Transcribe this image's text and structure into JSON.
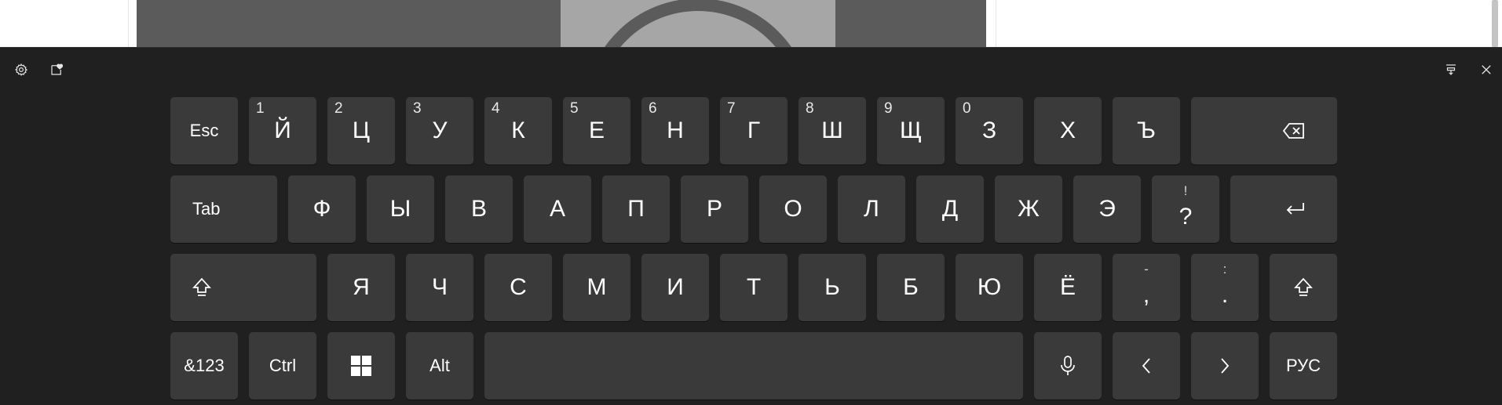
{
  "colors": {
    "background": "#202020",
    "key": "#3a3a3a",
    "text": "#ffffff"
  },
  "toolbar": {
    "settings_icon": "gear-icon",
    "emoji_icon": "emoji-panel-icon",
    "dock_icon": "keyboard-dock-icon",
    "close_icon": "close-icon"
  },
  "rows": {
    "r1": {
      "esc": "Esc",
      "keys": [
        {
          "main": "Й",
          "num": "1"
        },
        {
          "main": "Ц",
          "num": "2"
        },
        {
          "main": "У",
          "num": "3"
        },
        {
          "main": "К",
          "num": "4"
        },
        {
          "main": "Е",
          "num": "5"
        },
        {
          "main": "Н",
          "num": "6"
        },
        {
          "main": "Г",
          "num": "7"
        },
        {
          "main": "Ш",
          "num": "8"
        },
        {
          "main": "Щ",
          "num": "9"
        },
        {
          "main": "З",
          "num": "0"
        },
        {
          "main": "Х"
        },
        {
          "main": "Ъ"
        }
      ],
      "backspace_icon": "backspace-icon"
    },
    "r2": {
      "tab": "Tab",
      "keys": [
        "Ф",
        "Ы",
        "В",
        "А",
        "П",
        "Р",
        "О",
        "Л",
        "Д",
        "Ж",
        "Э"
      ],
      "qmark": {
        "upper": "!",
        "lower": "?"
      },
      "enter_icon": "enter-icon"
    },
    "r3": {
      "shift_icon": "shift-icon",
      "keys": [
        "Я",
        "Ч",
        "С",
        "М",
        "И",
        "Т",
        "Ь",
        "Б",
        "Ю",
        "Ё"
      ],
      "comma": {
        "upper": "-",
        "lower": ","
      },
      "period": {
        "upper": ":",
        "lower": "."
      }
    },
    "r4": {
      "symbols": "&123",
      "ctrl": "Ctrl",
      "win_icon": "windows-logo-icon",
      "alt": "Alt",
      "mic_icon": "microphone-icon",
      "left_icon": "chevron-left-icon",
      "right_icon": "chevron-right-icon",
      "lang": "РУС"
    }
  }
}
